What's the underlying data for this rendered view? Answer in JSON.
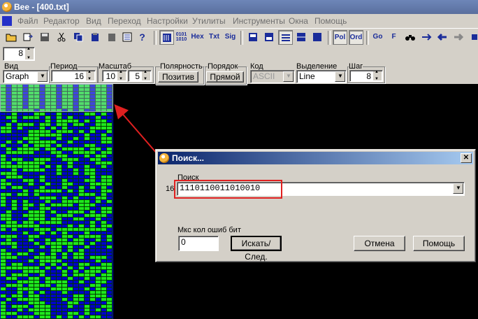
{
  "window": {
    "title": "Bee - [400.txt]"
  },
  "menu": [
    "Файл",
    "Редактор",
    "Вид",
    "Переход",
    "Настройки",
    "Утилиты",
    "Инструменты",
    "Окна",
    "Помощь"
  ],
  "toolbar": {
    "hex_label": "Hex",
    "txt_label": "Txt",
    "sig_label": "Sig",
    "bin_label_top": "0101",
    "bin_label_bottom": "1010",
    "pol_label": "Pol",
    "ord_label": "Ord",
    "go_label": "Go",
    "f_label": "F"
  },
  "top_spin": {
    "value": "8"
  },
  "params": {
    "view": {
      "label": "Вид",
      "value": "Graph"
    },
    "period": {
      "label": "Период",
      "value": "16"
    },
    "scale": {
      "label": "Масштаб",
      "value_a": "10",
      "value_b": "5"
    },
    "polarity": {
      "label": "Полярность",
      "button": "Позитив"
    },
    "order": {
      "label": "Порядок",
      "button": "Прямой"
    },
    "code": {
      "label": "Код",
      "value": "ASCII"
    },
    "selection": {
      "label": "Выделение",
      "value": "Line"
    },
    "step": {
      "label": "Шаг",
      "value": "8"
    }
  },
  "colors": {
    "bit_on": "#1ee61e",
    "bit_off": "#0000c8",
    "accent": "#e02020"
  },
  "dialog": {
    "title": "Поиск...",
    "search_label": "Поиск",
    "row_count": "16",
    "search_value": "1110110011010010",
    "max_errors_label": "Мкс кол ошиб бит",
    "max_errors_value": "0",
    "search_next_button": "Искать/След.",
    "cancel_button": "Отмена",
    "help_button": "Помощь"
  }
}
